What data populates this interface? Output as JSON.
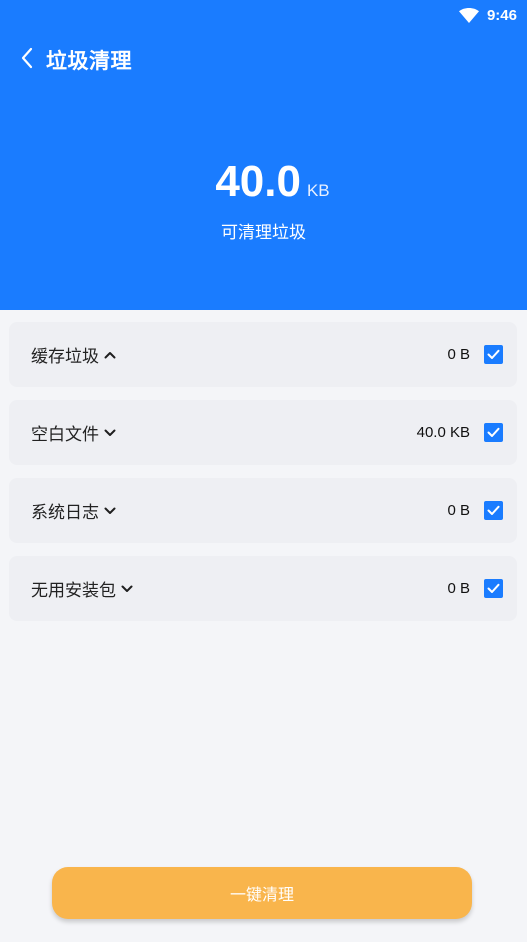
{
  "status_bar": {
    "time": "9:46",
    "wifi_icon": "wifi-icon"
  },
  "header": {
    "title": "垃圾清理",
    "back_icon": "chevron-left-icon",
    "background_color": "#1a7cff"
  },
  "summary": {
    "size_value": "40.0",
    "size_unit": "KB",
    "caption": "可清理垃圾"
  },
  "categories": [
    {
      "label": "缓存垃圾",
      "expanded": true,
      "chevron_icon": "chevron-up-icon",
      "size": "0 B",
      "checked": true
    },
    {
      "label": "空白文件",
      "expanded": false,
      "chevron_icon": "chevron-down-icon",
      "size": "40.0 KB",
      "checked": true
    },
    {
      "label": "系统日志",
      "expanded": false,
      "chevron_icon": "chevron-down-icon",
      "size": "0 B",
      "checked": true
    },
    {
      "label": "无用安装包",
      "expanded": false,
      "chevron_icon": "chevron-down-icon",
      "size": "0 B",
      "checked": true
    }
  ],
  "actions": {
    "clean_label": "一键清理",
    "clean_color": "#f9b54c"
  },
  "colors": {
    "accent": "#1a7cff",
    "checkbox": "#1a7cff",
    "page_background": "#f4f5f8"
  }
}
